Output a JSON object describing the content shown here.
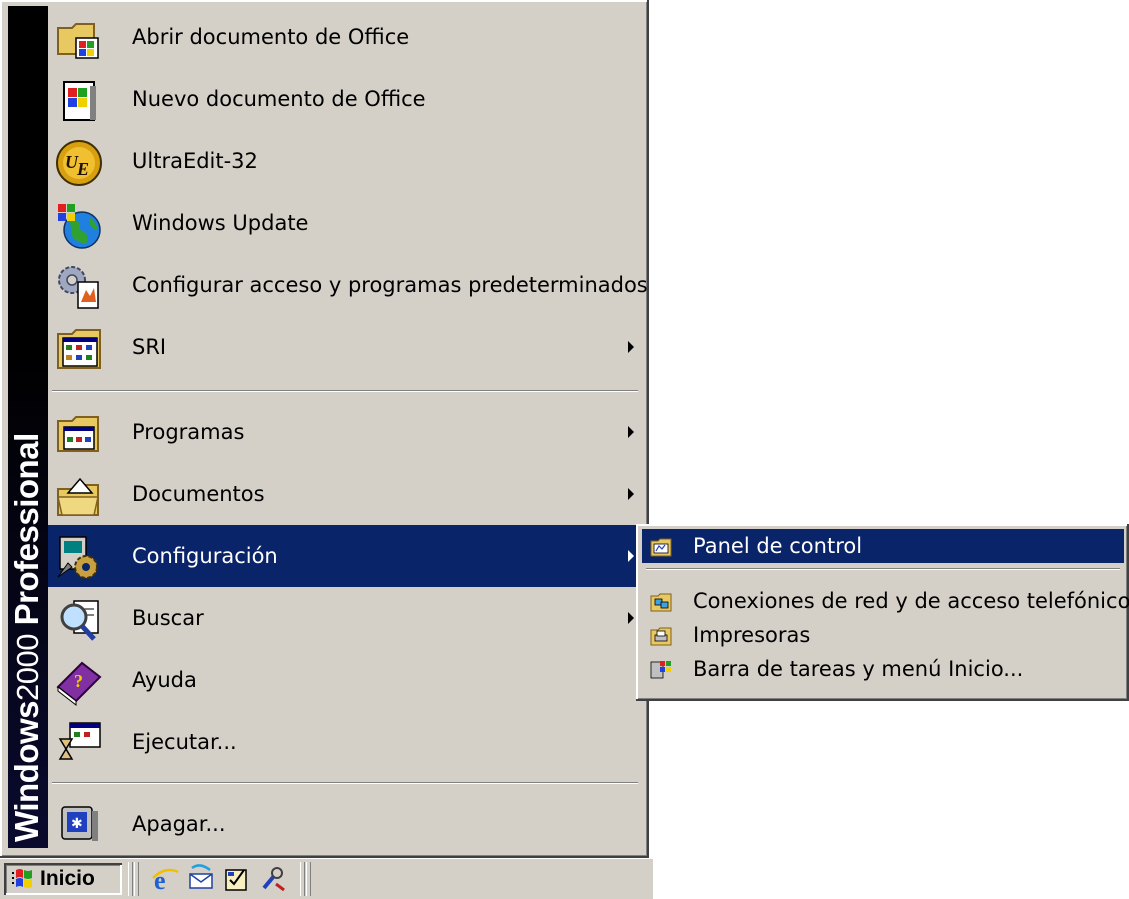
{
  "banner": {
    "windows": "Windows",
    "year": "2000",
    "edition": "Professional"
  },
  "start_menu": {
    "items": [
      {
        "label": "Abrir documento de Office",
        "icon": "open-office-document-icon",
        "submenu": false
      },
      {
        "label": "Nuevo documento de Office",
        "icon": "new-office-document-icon",
        "submenu": false
      },
      {
        "label": "UltraEdit-32",
        "icon": "ultraedit-icon",
        "submenu": false
      },
      {
        "label": "Windows Update",
        "icon": "windows-update-icon",
        "submenu": false
      },
      {
        "label": "Configurar acceso y programas predeterminados",
        "icon": "set-program-access-icon",
        "submenu": false
      },
      {
        "label": "SRI",
        "icon": "program-group-icon",
        "submenu": true
      },
      {
        "label": "Programas",
        "icon": "programs-icon",
        "submenu": true
      },
      {
        "label": "Documentos",
        "icon": "documents-icon",
        "submenu": true
      },
      {
        "label": "Configuración",
        "icon": "settings-icon",
        "submenu": true,
        "selected": true
      },
      {
        "label": "Buscar",
        "icon": "search-icon",
        "submenu": true
      },
      {
        "label": "Ayuda",
        "icon": "help-book-icon",
        "submenu": false
      },
      {
        "label": "Ejecutar...",
        "icon": "run-icon",
        "submenu": false
      },
      {
        "label": "Apagar...",
        "icon": "shutdown-icon",
        "submenu": false
      }
    ]
  },
  "settings_submenu": {
    "items": [
      {
        "label": "Panel de control",
        "icon": "control-panel-icon",
        "selected": true
      },
      {
        "label": "Conexiones de red y de acceso telefónico",
        "icon": "network-connections-icon"
      },
      {
        "label": "Impresoras",
        "icon": "printers-icon"
      },
      {
        "label": "Barra de tareas y menú Inicio...",
        "icon": "taskbar-start-menu-icon"
      }
    ]
  },
  "taskbar": {
    "start_label": "Inicio",
    "quick_launch": [
      "internet-explorer-icon",
      "outlook-express-icon",
      "show-desktop-icon",
      "tool-icon"
    ]
  },
  "colors": {
    "menu_bg": "#d4d0c8",
    "highlight": "#0a246a",
    "banner": "#000000"
  }
}
